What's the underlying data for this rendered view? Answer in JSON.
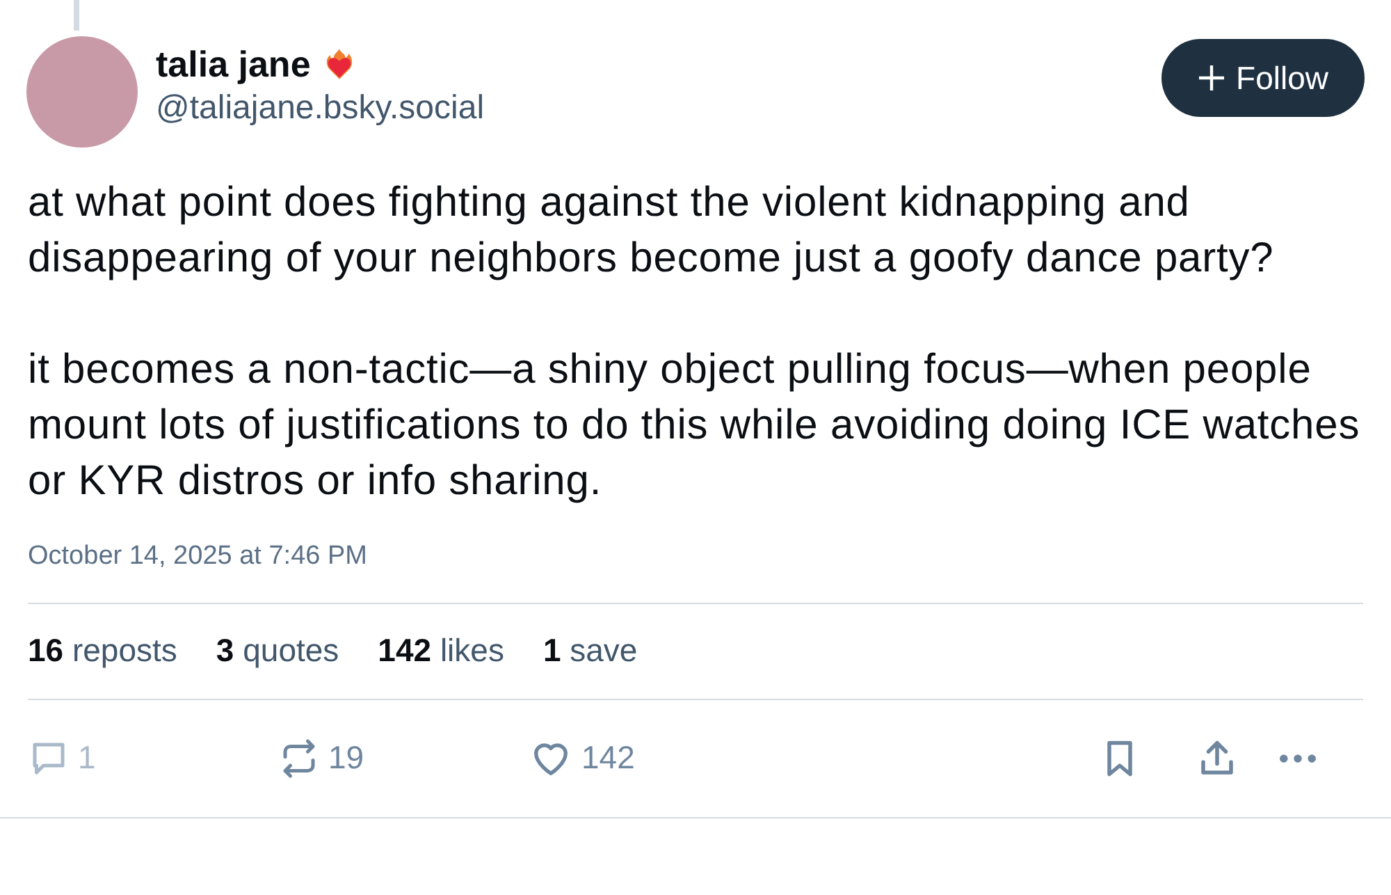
{
  "author": {
    "name": "talia jane",
    "handle": "@taliajane.bsky.social"
  },
  "follow_button": {
    "label": "Follow"
  },
  "post": {
    "paragraphs": [
      "at what point does fighting against the violent kidnapping and disappearing of your neighbors become just a goofy dance party?",
      "it becomes a non-tactic—a shiny object pulling focus—when people mount lots of justifications to do this while avoiding doing ICE watches or KYR distros or info sharing."
    ],
    "timestamp": "October 14, 2025 at 7:46 PM"
  },
  "stats": [
    {
      "count": "16",
      "label": "reposts"
    },
    {
      "count": "3",
      "label": "quotes"
    },
    {
      "count": "142",
      "label": "likes"
    },
    {
      "count": "1",
      "label": "save"
    }
  ],
  "actions": [
    {
      "kind": "reply",
      "count": "1",
      "disabled": true
    },
    {
      "kind": "repost",
      "count": "19",
      "disabled": false
    },
    {
      "kind": "like",
      "count": "142",
      "disabled": false
    },
    {
      "kind": "bookmark",
      "disabled": false
    },
    {
      "kind": "share",
      "disabled": false
    },
    {
      "kind": "more",
      "disabled": false
    }
  ]
}
